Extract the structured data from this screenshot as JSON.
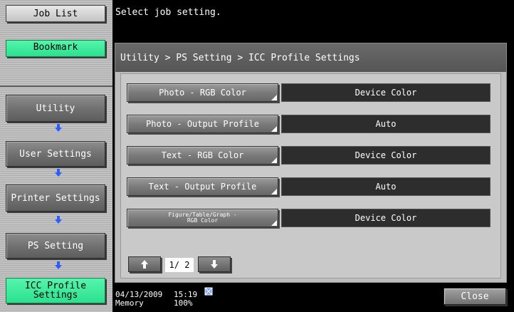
{
  "sidebar": {
    "job_list": "Job List",
    "bookmark": "Bookmark",
    "path": [
      "Utility",
      "User Settings",
      "Printer Settings",
      "PS Setting"
    ],
    "current": "ICC Profile Settings"
  },
  "message": "Select job setting.",
  "breadcrumb": "Utility > PS Setting > ICC Profile Settings",
  "settings": [
    {
      "label": "Photo - RGB Color",
      "value": "Device Color"
    },
    {
      "label": "Photo - Output Profile",
      "value": "Auto"
    },
    {
      "label": "Text - RGB Color",
      "value": "Device Color"
    },
    {
      "label": "Text - Output Profile",
      "value": "Auto"
    },
    {
      "label": "Figure/Table/Graph - RGB Color",
      "value": "Device Color"
    }
  ],
  "pagination": {
    "indicator": "1/ 2"
  },
  "status": {
    "date": "04/13/2009",
    "time": "15:19",
    "memory_label": "Memory",
    "memory_value": "100%"
  },
  "close_label": "Close",
  "colors": {
    "accent_green": "#2ce08e",
    "value_bg": "#2d2d2d",
    "panel_bg": "#bdbdbd"
  }
}
